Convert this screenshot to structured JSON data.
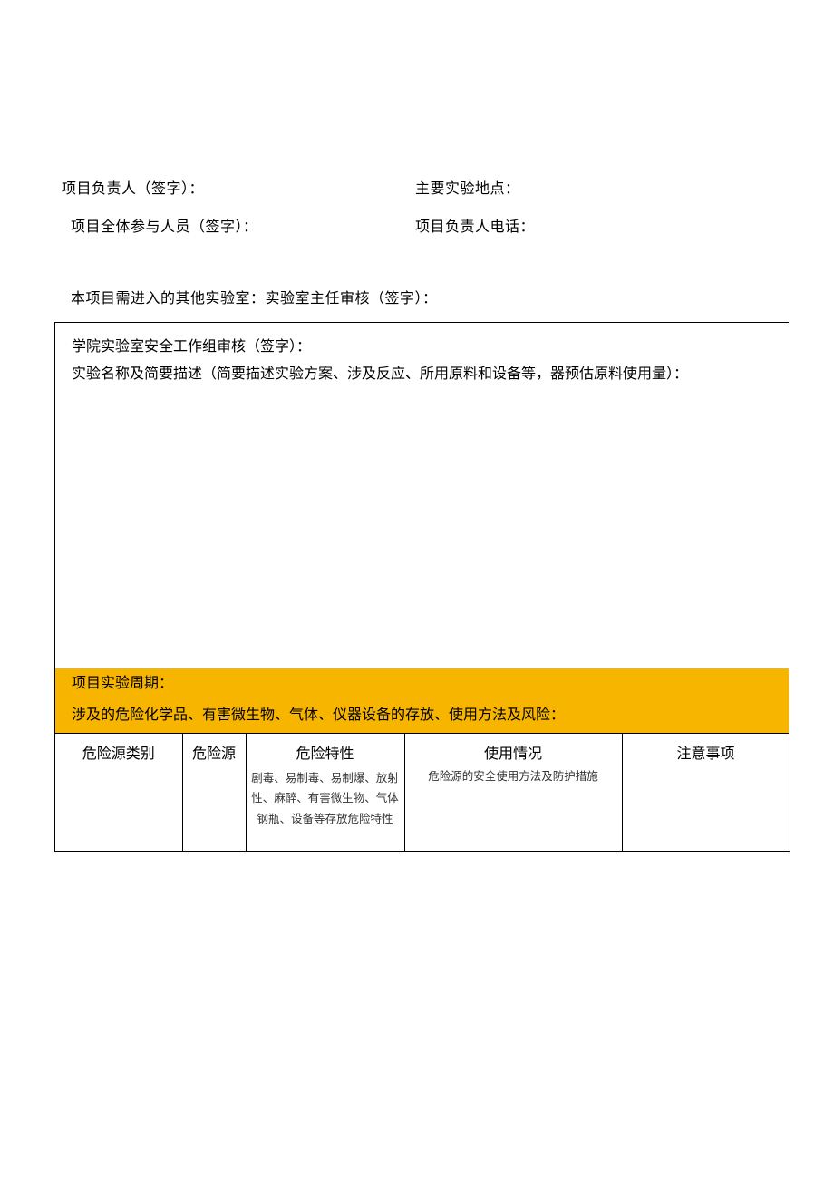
{
  "topFields": {
    "leader": "项目负责人（签字）：",
    "location": "主要实验地点：",
    "participants": "项目全体参与人员（签字）：",
    "leaderPhone": "项目负责人电话："
  },
  "otherLabs": "本项目需进入的其他实验室：实验室主任审核（签字）：",
  "box": {
    "collegeReview": "学院实验室安全工作组审核（签字）：",
    "experimentDesc": "实验名称及简要描述（简要描述实验方案、涉及反应、所用原料和设备等，器预估原料使用量）："
  },
  "highlight": {
    "period": "项目实验周期：",
    "riskTitle": "涉及的危险化学品、有害微生物、气体、仪器设备的存放、使用方法及风险："
  },
  "tableHeaders": {
    "category": "危险源类别",
    "source": "危险源",
    "characteristics": "危险特性",
    "characteristicsSub": "剧毒、易制毒、易制爆、放射性、麻醉、有害微生物、气体钢瓶、设备等存放危险特性",
    "usage": "使用情况",
    "usageSub": "危险源的安全使用方法及防护措施",
    "precautions": "注意事项"
  }
}
